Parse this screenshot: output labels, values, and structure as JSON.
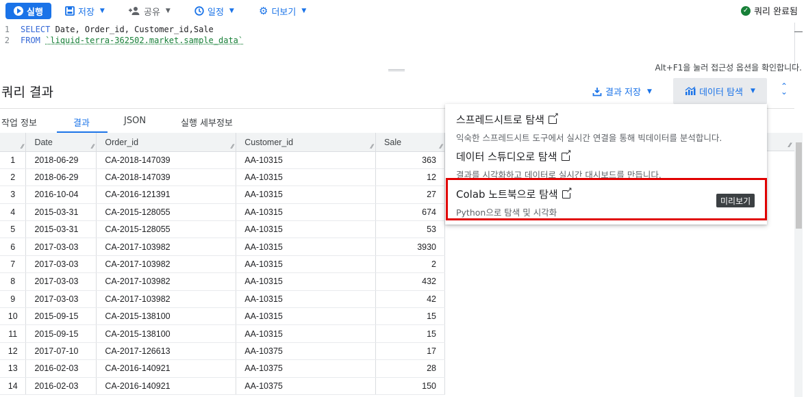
{
  "toolbar": {
    "run_label": "실행",
    "save_label": "저장",
    "share_label": "공유",
    "schedule_label": "일정",
    "more_label": "더보기",
    "status_label": "쿼리 완료됨"
  },
  "editor": {
    "lines": [
      {
        "num": "1",
        "keyword": "SELECT",
        "rest": " Date, Order_id, Customer_id,Sale"
      },
      {
        "num": "2",
        "keyword": "FROM",
        "space": " ",
        "table": "`liquid-terra-362502.market.sample_data`"
      }
    ],
    "a11y_hint": "Alt+F1을 눌러 접근성 옵션을 확인합니다."
  },
  "results": {
    "title": "쿼리 결과",
    "save_results_label": "결과 저장",
    "explore_label": "데이터 탐색"
  },
  "tabs": [
    {
      "label": "작업 정보"
    },
    {
      "label": "결과",
      "active": true
    },
    {
      "label": "JSON"
    },
    {
      "label": "실행 세부정보"
    }
  ],
  "table": {
    "columns": [
      "Date",
      "Order_id",
      "Customer_id",
      "Sale"
    ],
    "rows": [
      [
        "1",
        "2018-06-29",
        "CA-2018-147039",
        "AA-10315",
        "363"
      ],
      [
        "2",
        "2018-06-29",
        "CA-2018-147039",
        "AA-10315",
        "12"
      ],
      [
        "3",
        "2016-10-04",
        "CA-2016-121391",
        "AA-10315",
        "27"
      ],
      [
        "4",
        "2015-03-31",
        "CA-2015-128055",
        "AA-10315",
        "674"
      ],
      [
        "5",
        "2015-03-31",
        "CA-2015-128055",
        "AA-10315",
        "53"
      ],
      [
        "6",
        "2017-03-03",
        "CA-2017-103982",
        "AA-10315",
        "3930"
      ],
      [
        "7",
        "2017-03-03",
        "CA-2017-103982",
        "AA-10315",
        "2"
      ],
      [
        "8",
        "2017-03-03",
        "CA-2017-103982",
        "AA-10315",
        "432"
      ],
      [
        "9",
        "2017-03-03",
        "CA-2017-103982",
        "AA-10315",
        "42"
      ],
      [
        "10",
        "2015-09-15",
        "CA-2015-138100",
        "AA-10315",
        "15"
      ],
      [
        "11",
        "2015-09-15",
        "CA-2015-138100",
        "AA-10315",
        "15"
      ],
      [
        "12",
        "2017-07-10",
        "CA-2017-126613",
        "AA-10375",
        "17"
      ],
      [
        "13",
        "2016-02-03",
        "CA-2016-140921",
        "AA-10375",
        "28"
      ],
      [
        "14",
        "2016-02-03",
        "CA-2016-140921",
        "AA-10375",
        "150"
      ]
    ]
  },
  "explore_menu": {
    "items": [
      {
        "title": "스프레드시트로 탐색",
        "desc": "익숙한 스프레드시트 도구에서 실시간 연결을 통해 빅데이터를 분석합니다."
      },
      {
        "title": "데이터 스튜디오로 탐색",
        "desc": "결과를 시각화하고 데이터로 실시간 대시보드를 만듭니다."
      },
      {
        "title": "Colab 노트북으로 탐색",
        "desc": "Python으로 탐색 및 시각화",
        "badge": "미리보기"
      }
    ]
  },
  "colors": {
    "accent": "#1a73e8",
    "highlight_border": "#e00000",
    "status_ok": "#188038"
  }
}
